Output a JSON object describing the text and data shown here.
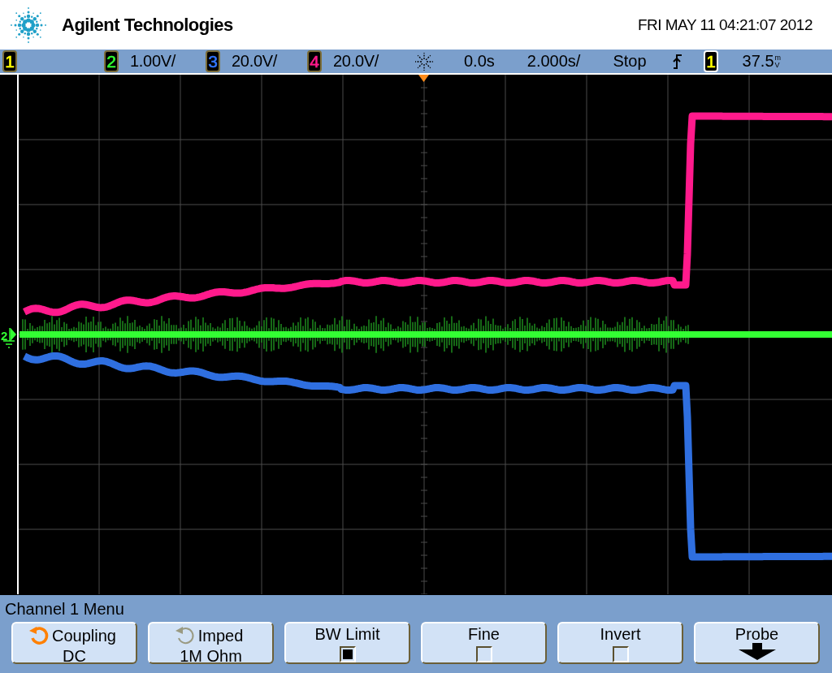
{
  "header": {
    "brand": "Agilent Technologies",
    "datetime": "FRI MAY 11 04:21:07 2012"
  },
  "status_bar": {
    "channels": [
      {
        "number": "1"
      },
      {
        "number": "2",
        "scale": "1.00V/"
      },
      {
        "number": "3",
        "scale": "20.0V/"
      },
      {
        "number": "4",
        "scale": "20.0V/"
      }
    ],
    "delay": "0.0s",
    "timebase": "2.000s/",
    "run_state": "Stop",
    "trigger": {
      "source": "1",
      "level": "37.5",
      "unit": "mV"
    }
  },
  "display": {
    "ground_marker": {
      "label": "2"
    }
  },
  "menu": {
    "title": "Channel 1  Menu",
    "softkeys": [
      {
        "kind": "rotary",
        "label": "Coupling",
        "value": "DC",
        "disabled": false
      },
      {
        "kind": "rotary",
        "label": "Imped",
        "value": "1M Ohm",
        "disabled": true
      },
      {
        "kind": "checkbox",
        "label": "BW Limit",
        "checked": true
      },
      {
        "kind": "checkbox",
        "label": "Fine",
        "checked": false
      },
      {
        "kind": "checkbox",
        "label": "Invert",
        "checked": false
      },
      {
        "kind": "submenu",
        "label": "Probe"
      }
    ]
  }
}
